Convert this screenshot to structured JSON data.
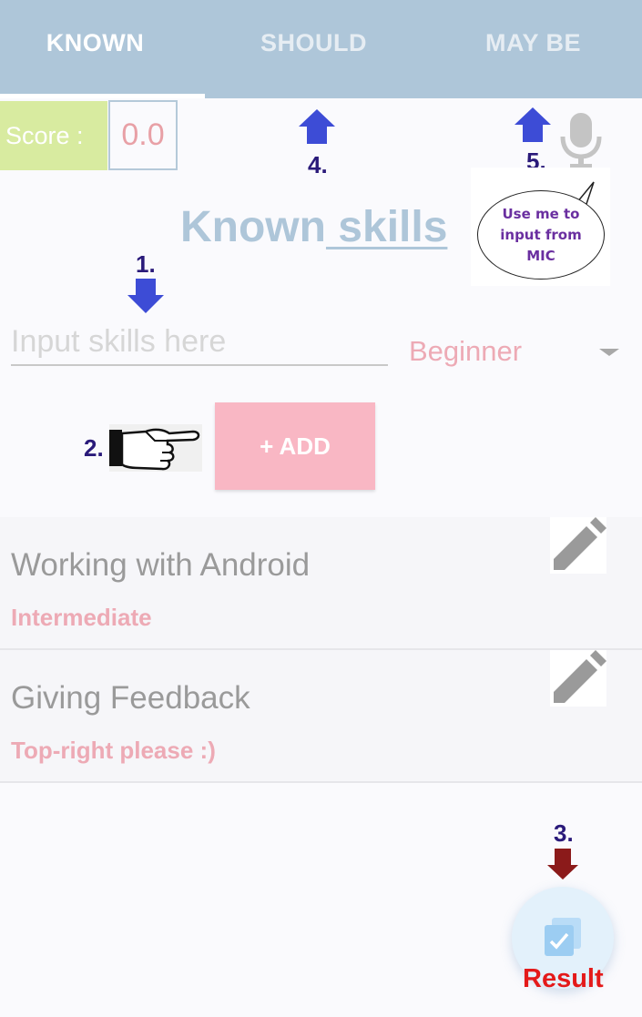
{
  "tabs": [
    {
      "label": "KNOWN",
      "selected": true
    },
    {
      "label": "SHOULD",
      "selected": false
    },
    {
      "label": "MAY BE",
      "selected": false
    }
  ],
  "score": {
    "label": "Score :",
    "value": "0.0"
  },
  "title": {
    "part1": "Known",
    "part2": " skills"
  },
  "input": {
    "placeholder": "Input skills here",
    "value": ""
  },
  "level_select": {
    "selected": "Beginner"
  },
  "add_button": {
    "label": "+ ADD"
  },
  "skills": [
    {
      "name": "Working with Android",
      "level": "Intermediate"
    },
    {
      "name": "Giving Feedback",
      "level": "Top-right please :)"
    }
  ],
  "annotations": {
    "step1": "1.",
    "step2": "2.",
    "step3": "3.",
    "step4": "4.",
    "step5": "5.",
    "mic_bubble": [
      "Use me to",
      "input from",
      "MIC"
    ]
  },
  "result": {
    "label": "Result"
  },
  "colors": {
    "tabbar": "#aec6d9",
    "accent_pink": "#f9b7c4",
    "score_green": "#d8eba0",
    "annotation_arrow": "#3d4cd6",
    "result_red": "#e41a1a"
  },
  "icons": [
    "mic-icon",
    "edit-icon",
    "pointing-hand-icon",
    "check-copy-icon"
  ]
}
